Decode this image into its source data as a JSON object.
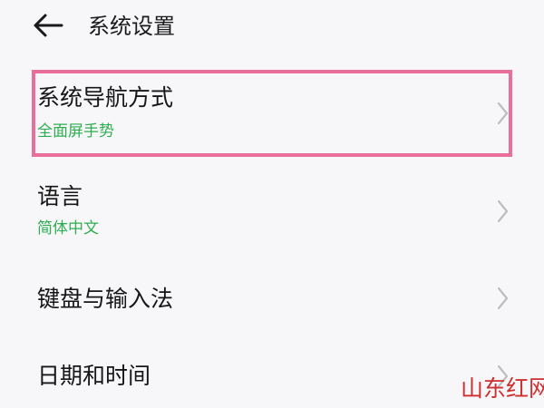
{
  "header": {
    "back_icon": "arrow-left-icon",
    "title": "系统设置"
  },
  "settings": [
    {
      "title": "系统导航方式",
      "subtitle": "全面屏手势",
      "highlighted": true
    },
    {
      "title": "语言",
      "subtitle": "简体中文",
      "highlighted": false
    },
    {
      "title": "键盘与输入法",
      "subtitle": "",
      "highlighted": false
    },
    {
      "title": "日期和时间",
      "subtitle": "",
      "highlighted": false
    }
  ],
  "chevron_icon": "chevron-right-icon",
  "colors": {
    "background": "#f7f6f8",
    "subtitle": "#2fae50",
    "highlight_border": "#e96f98",
    "chevron": "#bdbdbd",
    "watermark": "#cf2f2f"
  },
  "watermark": "山东红网"
}
